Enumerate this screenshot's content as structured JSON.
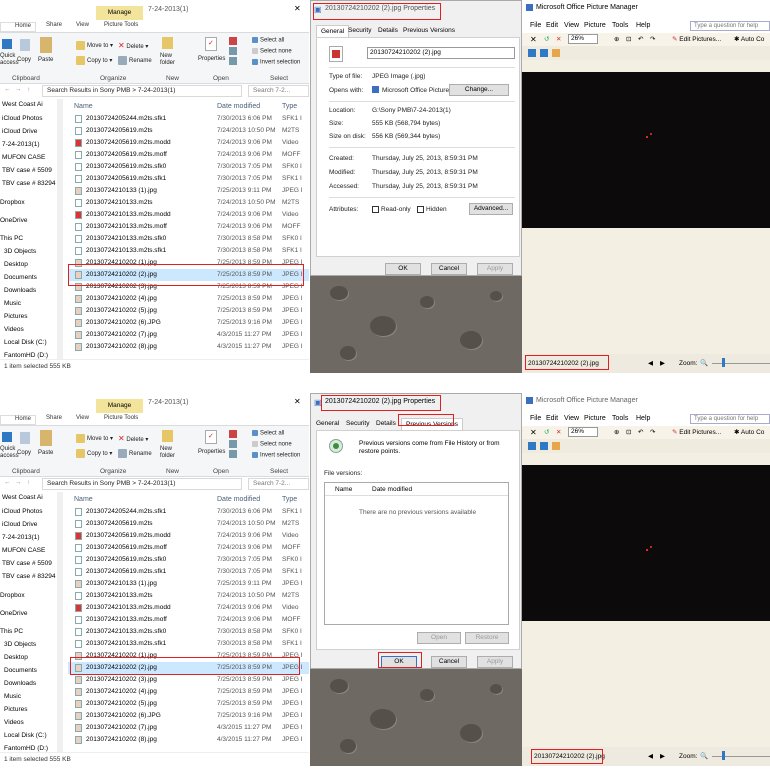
{
  "explorer": {
    "title": "7-24-2013(1)",
    "manage_label": "Manage",
    "picture_tools_label": "Picture Tools",
    "tabs": [
      "Home",
      "Share",
      "View"
    ],
    "ribbon": {
      "quick_label": "Quick",
      "access_label": "access",
      "copy_label": "Copy",
      "paste_label": "Paste",
      "move_to_label": "Move to ▾",
      "copy_to_label": "Copy to ▾",
      "delete_label": "Delete ▾",
      "rename_label": "Rename",
      "new_label": "New",
      "folder_label": "folder",
      "properties_label": "Properties",
      "select_all_label": "Select all",
      "select_none_label": "Select none",
      "invert_selection_label": "Invert selection",
      "clipboard_group": "Clipboard",
      "organize_group": "Organize",
      "new_group": "New",
      "open_group": "Open",
      "select_group": "Select"
    },
    "address": "Search Results in Sony PMB  >  7-24-2013(1)",
    "search_placeholder": "Search 7-2...",
    "nav_items": [
      "West Coast Ai",
      "iCloud Photos",
      "iCloud Drive",
      "7-24-2013(1)",
      "MUFON CASE",
      "TBV case # 5509",
      "TBV case # 83294",
      "Dropbox",
      "OneDrive",
      "This PC",
      "3D Objects",
      "Desktop",
      "Documents",
      "Downloads",
      "Music",
      "Pictures",
      "Videos",
      "Local Disk (C:)",
      "FantomHD (D:)"
    ],
    "columns": {
      "name": "Name",
      "date": "Date modified",
      "type": "Type"
    },
    "files": [
      {
        "name": "20130724205244.m2ts.sfk1",
        "date": "7/30/2013 6:06 PM",
        "type": "SFK1 I"
      },
      {
        "name": "20130724205619.m2ts",
        "date": "7/24/2013 10:50 PM",
        "type": "M2TS"
      },
      {
        "name": "20130724205619.m2ts.modd",
        "date": "7/24/2013 9:06 PM",
        "type": "Video"
      },
      {
        "name": "20130724205619.m2ts.moff",
        "date": "7/24/2013 9:06 PM",
        "type": "MOFF"
      },
      {
        "name": "20130724205619.m2ts.sfk0",
        "date": "7/30/2013 7:05 PM",
        "type": "SFK0 I"
      },
      {
        "name": "20130724205619.m2ts.sfk1",
        "date": "7/30/2013 7:05 PM",
        "type": "SFK1 I"
      },
      {
        "name": "20130724210133 (1).jpg",
        "date": "7/25/2013 9:11 PM",
        "type": "JPEG I"
      },
      {
        "name": "20130724210133.m2ts",
        "date": "7/24/2013 10:50 PM",
        "type": "M2TS"
      },
      {
        "name": "20130724210133.m2ts.modd",
        "date": "7/24/2013 9:06 PM",
        "type": "Video"
      },
      {
        "name": "20130724210133.m2ts.moff",
        "date": "7/24/2013 9:06 PM",
        "type": "MOFF"
      },
      {
        "name": "20130724210133.m2ts.sfk0",
        "date": "7/30/2013 8:58 PM",
        "type": "SFK0 I"
      },
      {
        "name": "20130724210133.m2ts.sfk1",
        "date": "7/30/2013 8:58 PM",
        "type": "SFK1 I"
      },
      {
        "name": "20130724210202 (1).jpg",
        "date": "7/25/2013 8:59 PM",
        "type": "JPEG I"
      },
      {
        "name": "20130724210202 (2).jpg",
        "date": "7/25/2013 8:59 PM",
        "type": "JPEG I"
      },
      {
        "name": "20130724210202 (3).jpg",
        "date": "7/25/2013 8:59 PM",
        "type": "JPEG I"
      },
      {
        "name": "20130724210202 (4).jpg",
        "date": "7/25/2013 8:59 PM",
        "type": "JPEG I"
      },
      {
        "name": "20130724210202 (5).jpg",
        "date": "7/25/2013 8:59 PM",
        "type": "JPEG I"
      },
      {
        "name": "20130724210202 (6).JPG",
        "date": "7/25/2013 9:16 PM",
        "type": "JPEG I"
      },
      {
        "name": "20130724210202 (7).jpg",
        "date": "4/3/2015 11:27 PM",
        "type": "JPEG I"
      },
      {
        "name": "20130724210202 (8).jpg",
        "date": "4/3/2015 11:27 PM",
        "type": "JPEG I"
      }
    ],
    "status": "1 item selected  555 KB"
  },
  "properties": {
    "title": "20130724210202 (2).jpg Properties",
    "tabs": [
      "General",
      "Security",
      "Details",
      "Previous Versions"
    ],
    "file_name": "20130724210202 (2).jpg",
    "type_label": "Type of file:",
    "type_value": "JPEG Image (.jpg)",
    "opens_label": "Opens with:",
    "opens_value": "Microsoft Office Picture M",
    "change_label": "Change...",
    "location_label": "Location:",
    "location_value": "G:\\Sony PMB\\7-24-2013(1)",
    "size_label": "Size:",
    "size_value": "555 KB (568,794 bytes)",
    "size_disk_label": "Size on disk:",
    "size_disk_value": "556 KB (569,344 bytes)",
    "created_label": "Created:",
    "created_value": "Thursday, July 25, 2013, 8:59:31 PM",
    "modified_label": "Modified:",
    "modified_value": "Thursday, July 25, 2013, 8:59:31 PM",
    "accessed_label": "Accessed:",
    "accessed_value": "Thursday, July 25, 2013, 8:59:31 PM",
    "attributes_label": "Attributes:",
    "readonly_label": "Read-only",
    "hidden_label": "Hidden",
    "advanced_label": "Advanced...",
    "ok_label": "OK",
    "cancel_label": "Cancel",
    "apply_label": "Apply",
    "pv_description": "Previous versions come from File History or from restore points.",
    "file_versions_label": "File versions:",
    "pv_col_name": "Name",
    "pv_col_date": "Date modified",
    "pv_empty": "There are no previous versions available",
    "open_label": "Open",
    "restore_label": "Restore"
  },
  "picture_manager": {
    "title": "Microsoft Office Picture Manager",
    "menu": [
      "File",
      "Edit",
      "View",
      "Picture",
      "Tools",
      "Help"
    ],
    "help_placeholder": "Type a question for help",
    "zoom_value": "26%",
    "edit_pictures_label": "Edit Pictures...",
    "auto_correct_label": "Auto Co",
    "status_file": "20130724210202 (2).jpg",
    "zoom_label": "Zoom:"
  }
}
